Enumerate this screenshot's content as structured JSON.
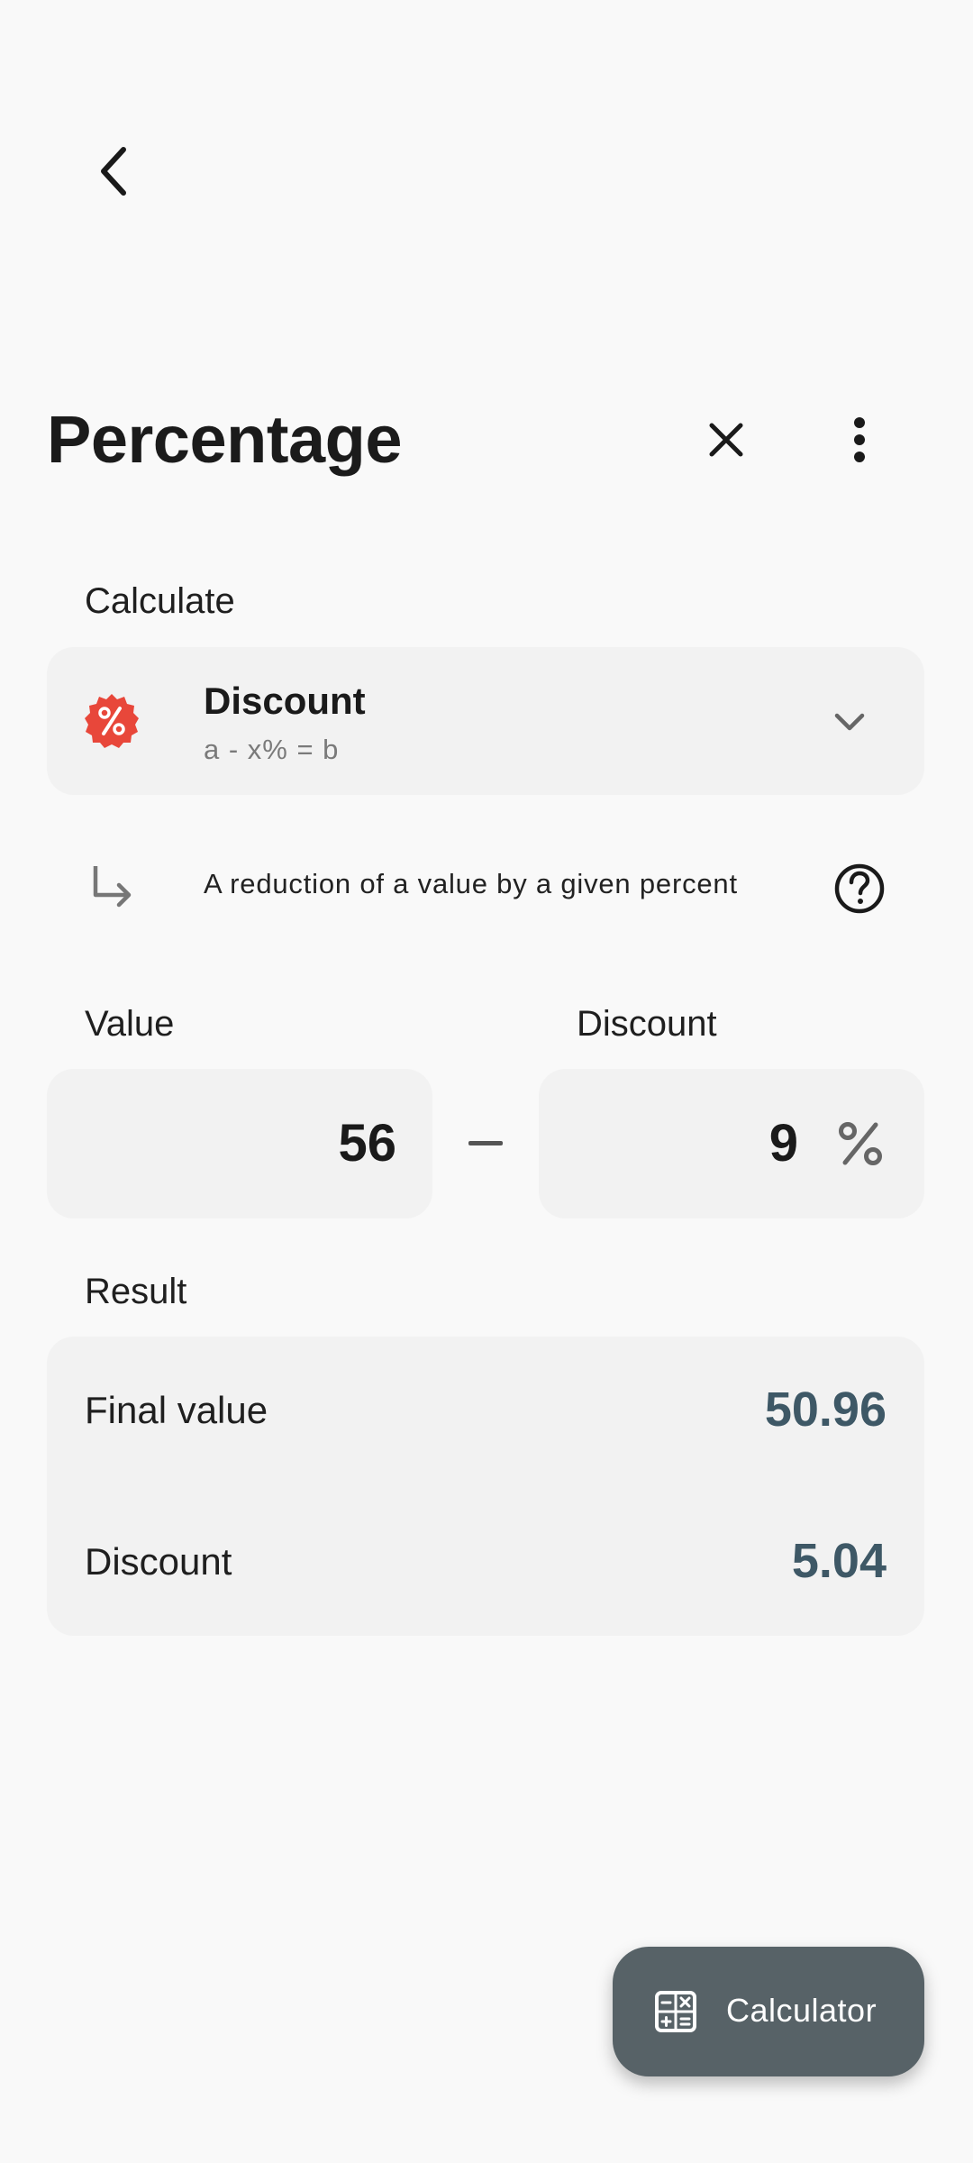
{
  "header": {
    "back_icon": "chevron-left-icon",
    "title": "Percentage",
    "close_icon": "close-icon",
    "more_icon": "more-vert-icon"
  },
  "calculate": {
    "label": "Calculate",
    "mode": {
      "name": "Discount",
      "formula": "a - x% = b",
      "badge_icon": "percent-badge-icon",
      "badge_color": "#e8473a",
      "chevron_icon": "chevron-down-icon"
    },
    "description": "A reduction of a value by a given percent",
    "help_icon": "help-circle-icon"
  },
  "inputs": {
    "value_label": "Value",
    "value": "56",
    "operator": "minus",
    "discount_label": "Discount",
    "discount": "9",
    "discount_suffix": "%"
  },
  "result": {
    "label": "Result",
    "rows": [
      {
        "label": "Final value",
        "value": "50.96"
      },
      {
        "label": "Discount",
        "value": "5.04"
      }
    ],
    "value_color": "#3e5866"
  },
  "fab": {
    "label": "Calculator",
    "icon": "calculator-icon",
    "color": "#576267"
  }
}
